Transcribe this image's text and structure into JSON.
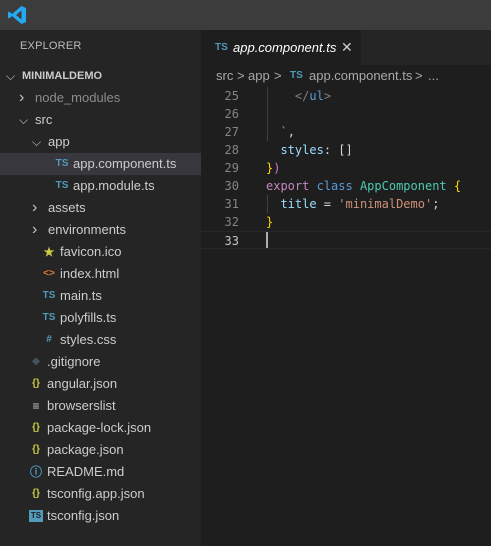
{
  "sidebar": {
    "title": "EXPLORER",
    "items": [
      {
        "label": "MINIMALDEMO",
        "depth": 0,
        "kind": "root",
        "twisty": "open",
        "icon": ""
      },
      {
        "label": "node_modules",
        "depth": 1,
        "kind": "folder",
        "twisty": "closed",
        "icon": "",
        "muted": true
      },
      {
        "label": "src",
        "depth": 1,
        "kind": "folder",
        "twisty": "open",
        "icon": ""
      },
      {
        "label": "app",
        "depth": 2,
        "kind": "folder",
        "twisty": "open",
        "icon": ""
      },
      {
        "label": "app.component.ts",
        "depth": 3,
        "kind": "file",
        "icon": "typescript-icon",
        "selected": true
      },
      {
        "label": "app.module.ts",
        "depth": 3,
        "kind": "file",
        "icon": "typescript-icon"
      },
      {
        "label": "assets",
        "depth": 2,
        "kind": "folder",
        "twisty": "closed",
        "icon": ""
      },
      {
        "label": "environments",
        "depth": 2,
        "kind": "folder",
        "twisty": "closed",
        "icon": ""
      },
      {
        "label": "favicon.ico",
        "depth": 2,
        "kind": "file",
        "icon": "star-icon"
      },
      {
        "label": "index.html",
        "depth": 2,
        "kind": "file",
        "icon": "html-icon"
      },
      {
        "label": "main.ts",
        "depth": 2,
        "kind": "file",
        "icon": "typescript-icon"
      },
      {
        "label": "polyfills.ts",
        "depth": 2,
        "kind": "file",
        "icon": "typescript-icon"
      },
      {
        "label": "styles.css",
        "depth": 2,
        "kind": "file",
        "icon": "css-hash-icon"
      },
      {
        "label": ".gitignore",
        "depth": 1,
        "kind": "file",
        "icon": "git-icon"
      },
      {
        "label": "angular.json",
        "depth": 1,
        "kind": "file",
        "icon": "json-braces-icon"
      },
      {
        "label": "browserslist",
        "depth": 1,
        "kind": "file",
        "icon": "lines-icon"
      },
      {
        "label": "package-lock.json",
        "depth": 1,
        "kind": "file",
        "icon": "json-braces-icon"
      },
      {
        "label": "package.json",
        "depth": 1,
        "kind": "file",
        "icon": "json-braces-icon"
      },
      {
        "label": "README.md",
        "depth": 1,
        "kind": "file",
        "icon": "info-icon"
      },
      {
        "label": "tsconfig.app.json",
        "depth": 1,
        "kind": "file",
        "icon": "json-braces-icon"
      },
      {
        "label": "tsconfig.json",
        "depth": 1,
        "kind": "file",
        "icon": "tsconfig-icon"
      }
    ]
  },
  "icons": {
    "typescript-icon": "TS",
    "star-icon": "★",
    "html-icon": "<>",
    "css-hash-icon": "#",
    "git-icon": "◆",
    "json-braces-icon": "{}",
    "lines-icon": "≡",
    "info-icon": "ⓘ",
    "tsconfig-icon": "TS"
  },
  "tab": {
    "icon_label": "TS",
    "label": "app.component.ts",
    "close_glyph": "✕"
  },
  "breadcrumb": {
    "segments": [
      "src",
      "app",
      "app.component.ts"
    ],
    "icon_label": "TS",
    "separator": ">",
    "trailing": "..."
  },
  "code": {
    "lines": [
      {
        "n": "25",
        "tokens": [
          [
            "    ",
            ""
          ],
          [
            "</",
            "c-tag"
          ],
          [
            "ul",
            "c-tagname"
          ],
          [
            ">",
            "c-tag"
          ]
        ]
      },
      {
        "n": "26",
        "tokens": []
      },
      {
        "n": "27",
        "tokens": [
          [
            "  ",
            ""
          ],
          [
            "`",
            "c-str"
          ],
          [
            ",",
            "c-punc"
          ]
        ]
      },
      {
        "n": "28",
        "tokens": [
          [
            "  ",
            ""
          ],
          [
            "styles",
            "c-prop"
          ],
          [
            ": ",
            "c-punc"
          ],
          [
            "[]",
            "c-punc"
          ]
        ]
      },
      {
        "n": "29",
        "tokens": [
          [
            "}",
            "c-brace"
          ],
          [
            ")",
            "c-paren"
          ]
        ]
      },
      {
        "n": "30",
        "tokens": [
          [
            "export",
            "c-kw"
          ],
          [
            " ",
            ""
          ],
          [
            "class",
            "c-kw2"
          ],
          [
            " ",
            ""
          ],
          [
            "AppComponent",
            "c-cls"
          ],
          [
            " ",
            ""
          ],
          [
            "{",
            "c-brace"
          ]
        ]
      },
      {
        "n": "31",
        "tokens": [
          [
            "  ",
            ""
          ],
          [
            "title",
            "c-prop"
          ],
          [
            " = ",
            "c-punc"
          ],
          [
            "'minimalDemo'",
            "c-str"
          ],
          [
            ";",
            "c-punc"
          ]
        ]
      },
      {
        "n": "32",
        "tokens": [
          [
            "}",
            "c-brace"
          ]
        ]
      },
      {
        "n": "33",
        "tokens": [],
        "current": true
      }
    ]
  },
  "colors": {
    "accent_ts": "#519aba",
    "star": "#cbcb41",
    "html": "#e37933",
    "css": "#519aba",
    "json": "#cbcb41",
    "git": "#41535b",
    "info": "#519aba"
  }
}
